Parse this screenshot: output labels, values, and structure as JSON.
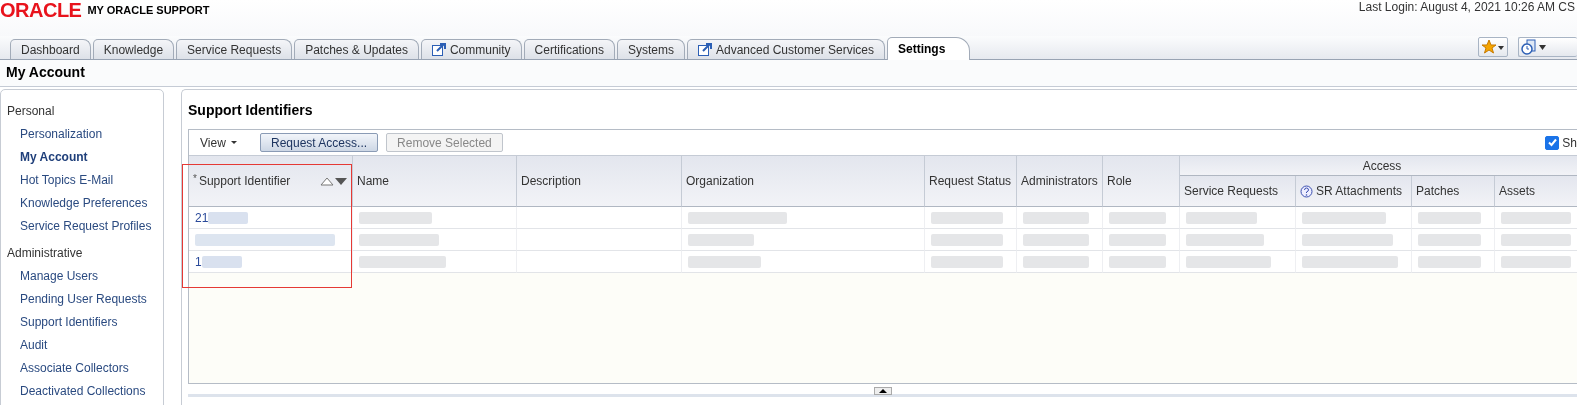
{
  "header": {
    "logo": "ORACLE",
    "product": "MY ORACLE SUPPORT",
    "last_login": "Last Login: August 4, 2021 10:26 AM CS"
  },
  "tabs": [
    {
      "label": "Dashboard",
      "external": false,
      "selected": false
    },
    {
      "label": "Knowledge",
      "external": false,
      "selected": false
    },
    {
      "label": "Service Requests",
      "external": false,
      "selected": false
    },
    {
      "label": "Patches & Updates",
      "external": false,
      "selected": false
    },
    {
      "label": "Community",
      "external": true,
      "selected": false
    },
    {
      "label": "Certifications",
      "external": false,
      "selected": false
    },
    {
      "label": "Systems",
      "external": false,
      "selected": false
    },
    {
      "label": "Advanced Customer Services",
      "external": true,
      "selected": false
    },
    {
      "label": "Settings",
      "external": false,
      "selected": true
    }
  ],
  "page_title": "My Account",
  "sidebar": {
    "sections": [
      {
        "title": "Personal",
        "items": [
          {
            "label": "Personalization",
            "selected": false
          },
          {
            "label": "My Account",
            "selected": true
          },
          {
            "label": "Hot Topics E-Mail",
            "selected": false
          },
          {
            "label": "Knowledge Preferences",
            "selected": false
          },
          {
            "label": "Service Request Profiles",
            "selected": false
          }
        ]
      },
      {
        "title": "Administrative",
        "items": [
          {
            "label": "Manage Users",
            "selected": false
          },
          {
            "label": "Pending User Requests",
            "selected": false
          },
          {
            "label": "Support Identifiers",
            "selected": false
          },
          {
            "label": "Audit",
            "selected": false
          },
          {
            "label": "Associate Collectors",
            "selected": false
          },
          {
            "label": "Deactivated Collections",
            "selected": false
          }
        ]
      }
    ]
  },
  "panel": {
    "title": "Support Identifiers",
    "toolbar": {
      "view_menu": "View",
      "buttons": [
        {
          "label": "Request Access...",
          "disabled": false
        },
        {
          "label": "Remove Selected",
          "disabled": true
        }
      ],
      "checkbox": {
        "label": "Sh",
        "checked": true
      }
    },
    "table": {
      "columns": [
        {
          "label": "Support Identifier",
          "required_mark": "*",
          "sortable": true
        },
        {
          "label": "Name",
          "sortable": false
        },
        {
          "label": "Description",
          "sortable": false
        },
        {
          "label": "Organization",
          "sortable": false
        },
        {
          "label": "Request Status",
          "sortable": false
        },
        {
          "label": "Administrators",
          "sortable": false
        },
        {
          "label": "Role",
          "sortable": false
        }
      ],
      "column_group": {
        "label": "Access",
        "columns": [
          {
            "label": "Service Requests",
            "help": false
          },
          {
            "label": "SR Attachments",
            "help": true
          },
          {
            "label": "Patches",
            "help": false
          },
          {
            "label": "Assets",
            "help": false
          }
        ]
      },
      "rows": [
        {
          "support_identifier": "21"
        },
        {
          "blurred": true
        },
        {
          "support_identifier": "1"
        }
      ]
    }
  }
}
